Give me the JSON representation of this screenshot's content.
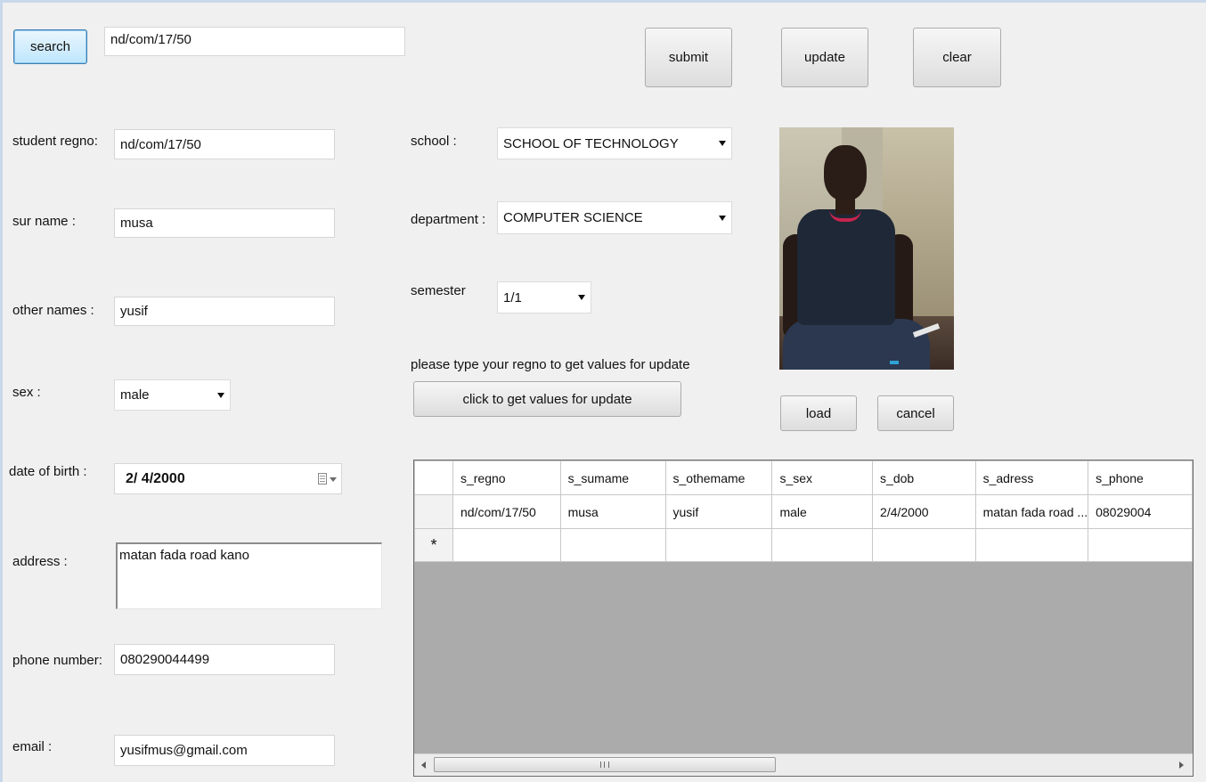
{
  "toolbar": {
    "search_label": "search",
    "search_value": "nd/com/17/50",
    "submit_label": "submit",
    "update_label": "update",
    "clear_label": "clear"
  },
  "form": {
    "regno": {
      "label": "student regno:",
      "value": "nd/com/17/50"
    },
    "surname": {
      "label": "sur name :",
      "value": "musa"
    },
    "othernames": {
      "label": "other names :",
      "value": "yusif"
    },
    "sex": {
      "label": "sex :",
      "value": "male"
    },
    "dob": {
      "label": "date of birth :",
      "value": "2/ 4/2000"
    },
    "address": {
      "label": "address :",
      "value": "matan fada road kano"
    },
    "phone": {
      "label": "phone number:",
      "value": "080290044499"
    },
    "email": {
      "label": "email :",
      "value": "yusifmus@gmail.com"
    },
    "school": {
      "label": "school :",
      "value": "SCHOOL OF TECHNOLOGY"
    },
    "department": {
      "label": "department :",
      "value": "COMPUTER SCIENCE"
    },
    "semester": {
      "label": "semester",
      "value": "1/1"
    }
  },
  "update_hint": "please type your regno to get values for update",
  "get_values_label": "click to get values for update",
  "photo": {
    "load_label": "load",
    "cancel_label": "cancel"
  },
  "grid": {
    "headers": [
      "s_regno",
      "s_sumame",
      "s_othemame",
      "s_sex",
      "s_dob",
      "s_adress",
      "s_phone"
    ],
    "rows": [
      [
        "nd/com/17/50",
        "musa",
        "yusif",
        "male",
        "2/4/2000",
        "matan fada road ...",
        "08029004"
      ]
    ],
    "new_row_marker": "*",
    "scroll_grip": "III"
  }
}
